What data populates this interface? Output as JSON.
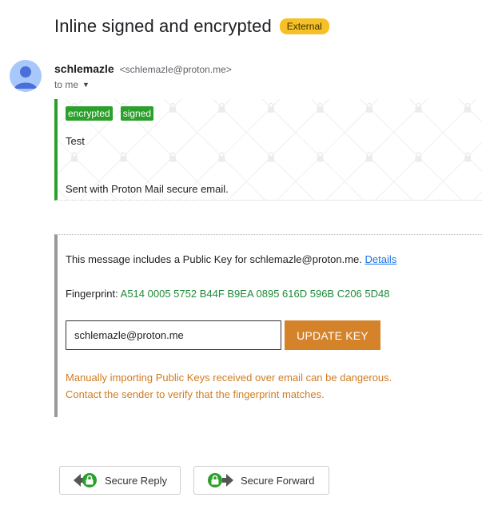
{
  "email": {
    "subject": "Inline signed and encrypted",
    "external_badge": "External",
    "sender_name": "schlemazle",
    "sender_email": "<schlemazle@proton.me>",
    "recipient_label": "to me"
  },
  "message": {
    "tags": [
      "encrypted",
      "signed"
    ],
    "body": "Test",
    "footer": "Sent with Proton Mail secure email."
  },
  "public_key": {
    "info_text": "This message includes a Public Key for schlemazle@proton.me.",
    "details_link": "Details",
    "fingerprint_label": "Fingerprint:",
    "fingerprint_value": "A514 0005 5752 B44F B9EA 0895 616D 596B C206 5D48",
    "email_value": "schlemazle@proton.me",
    "update_button": "UPDATE KEY",
    "warning_line1": "Manually importing Public Keys received over email can be dangerous.",
    "warning_line2": "Contact the sender to verify that the fingerprint matches."
  },
  "actions": {
    "reply_label": "Secure Reply",
    "forward_label": "Secure Forward"
  },
  "colors": {
    "external_badge": "#f6c026",
    "secure_green": "#2ba02b",
    "fingerprint_green": "#1f8a3a",
    "update_button": "#d4832b",
    "warning_text": "#cf7c22",
    "link": "#1a73e8"
  },
  "icons": {
    "avatar": "default-person-avatar",
    "recipients_toggle": "caret-down-icon",
    "reply": "reply-arrow-lock-icon",
    "forward": "forward-arrow-lock-icon"
  }
}
